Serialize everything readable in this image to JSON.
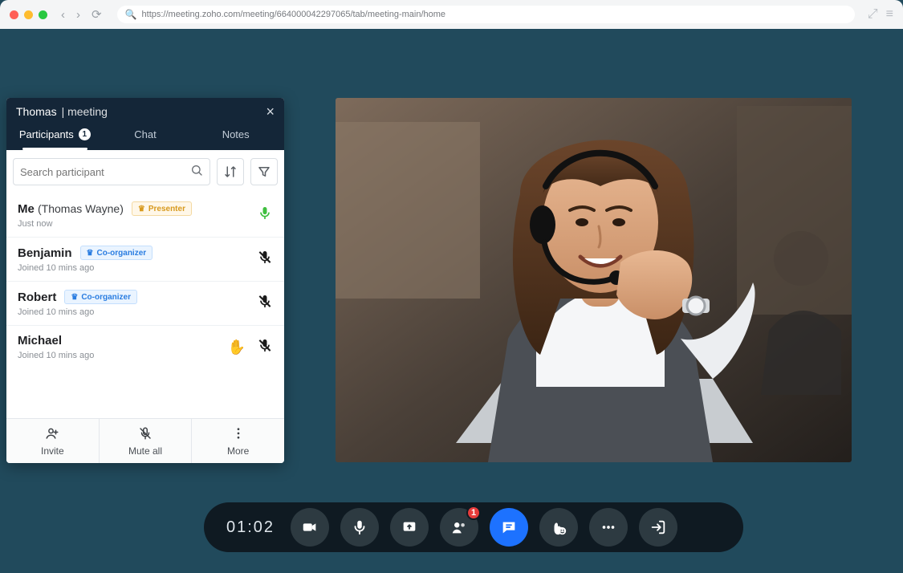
{
  "browser": {
    "url": "https://meeting.zoho.com/meeting/664000042297065/tab/meeting-main/home"
  },
  "panel": {
    "title_name": "Thomas",
    "title_suffix": "| meeting",
    "tab_participants": "Participants",
    "participants_count": "1",
    "tab_chat": "Chat",
    "tab_notes": "Notes",
    "search_placeholder": "Search participant"
  },
  "participants": [
    {
      "name": "Me",
      "paren": "(Thomas Wayne)",
      "role_label": "Presenter",
      "role_type": "presenter",
      "joined": "Just now",
      "mic": "on",
      "hand": false
    },
    {
      "name": "Benjamin",
      "paren": "",
      "role_label": "Co-organizer",
      "role_type": "coorg",
      "joined": "Joined 10 mins ago",
      "mic": "muted",
      "hand": false
    },
    {
      "name": "Robert",
      "paren": "",
      "role_label": "Co-organizer",
      "role_type": "coorg",
      "joined": "Joined 10 mins ago",
      "mic": "muted",
      "hand": false
    },
    {
      "name": "Michael",
      "paren": "",
      "role_label": "",
      "role_type": "",
      "joined": "Joined 10 mins ago",
      "mic": "muted",
      "hand": true
    }
  ],
  "footer": {
    "invite": "Invite",
    "mute_all": "Mute all",
    "more": "More"
  },
  "controls": {
    "timer": "01:02",
    "participants_badge": "1"
  }
}
